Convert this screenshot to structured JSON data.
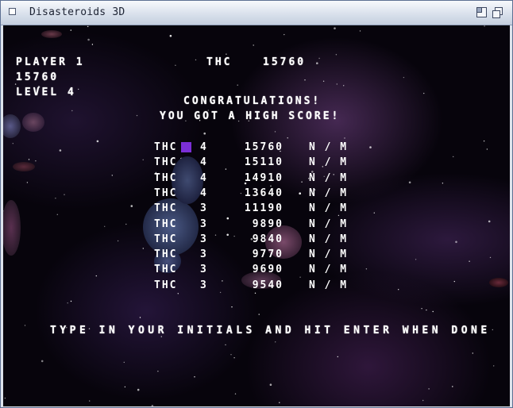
{
  "window": {
    "title": "Disasteroids 3D"
  },
  "hud": {
    "player_label": "PLAYER 1",
    "score": "15760",
    "level_label": "LEVEL 4",
    "top_initials": "THC",
    "top_score": "15760"
  },
  "message": {
    "congrats": "CONGRATULATIONS!",
    "high_score": "YOU GOT A HIGH SCORE!",
    "instructions": "TYPE IN YOUR INITIALS AND HIT ENTER WHEN DONE"
  },
  "high_scores": [
    {
      "initials": "THC",
      "level": "4",
      "score": "15760",
      "mode": "N / M"
    },
    {
      "initials": "THC",
      "level": "4",
      "score": "15110",
      "mode": "N / M"
    },
    {
      "initials": "THC",
      "level": "4",
      "score": "14910",
      "mode": "N / M"
    },
    {
      "initials": "THC",
      "level": "4",
      "score": "13640",
      "mode": "N / M"
    },
    {
      "initials": "THC",
      "level": "3",
      "score": "11190",
      "mode": "N / M"
    },
    {
      "initials": "THC",
      "level": "3",
      "score": "9890",
      "mode": "N / M"
    },
    {
      "initials": "THC",
      "level": "3",
      "score": "9840",
      "mode": "N / M"
    },
    {
      "initials": "THC",
      "level": "3",
      "score": "9770",
      "mode": "N / M"
    },
    {
      "initials": "THC",
      "level": "3",
      "score": "9690",
      "mode": "N / M"
    },
    {
      "initials": "THC",
      "level": "3",
      "score": "9540",
      "mode": "N / M"
    }
  ],
  "colors": {
    "cursor": "#7b2fd6",
    "text": "#ffffff",
    "space": "#07040c"
  }
}
